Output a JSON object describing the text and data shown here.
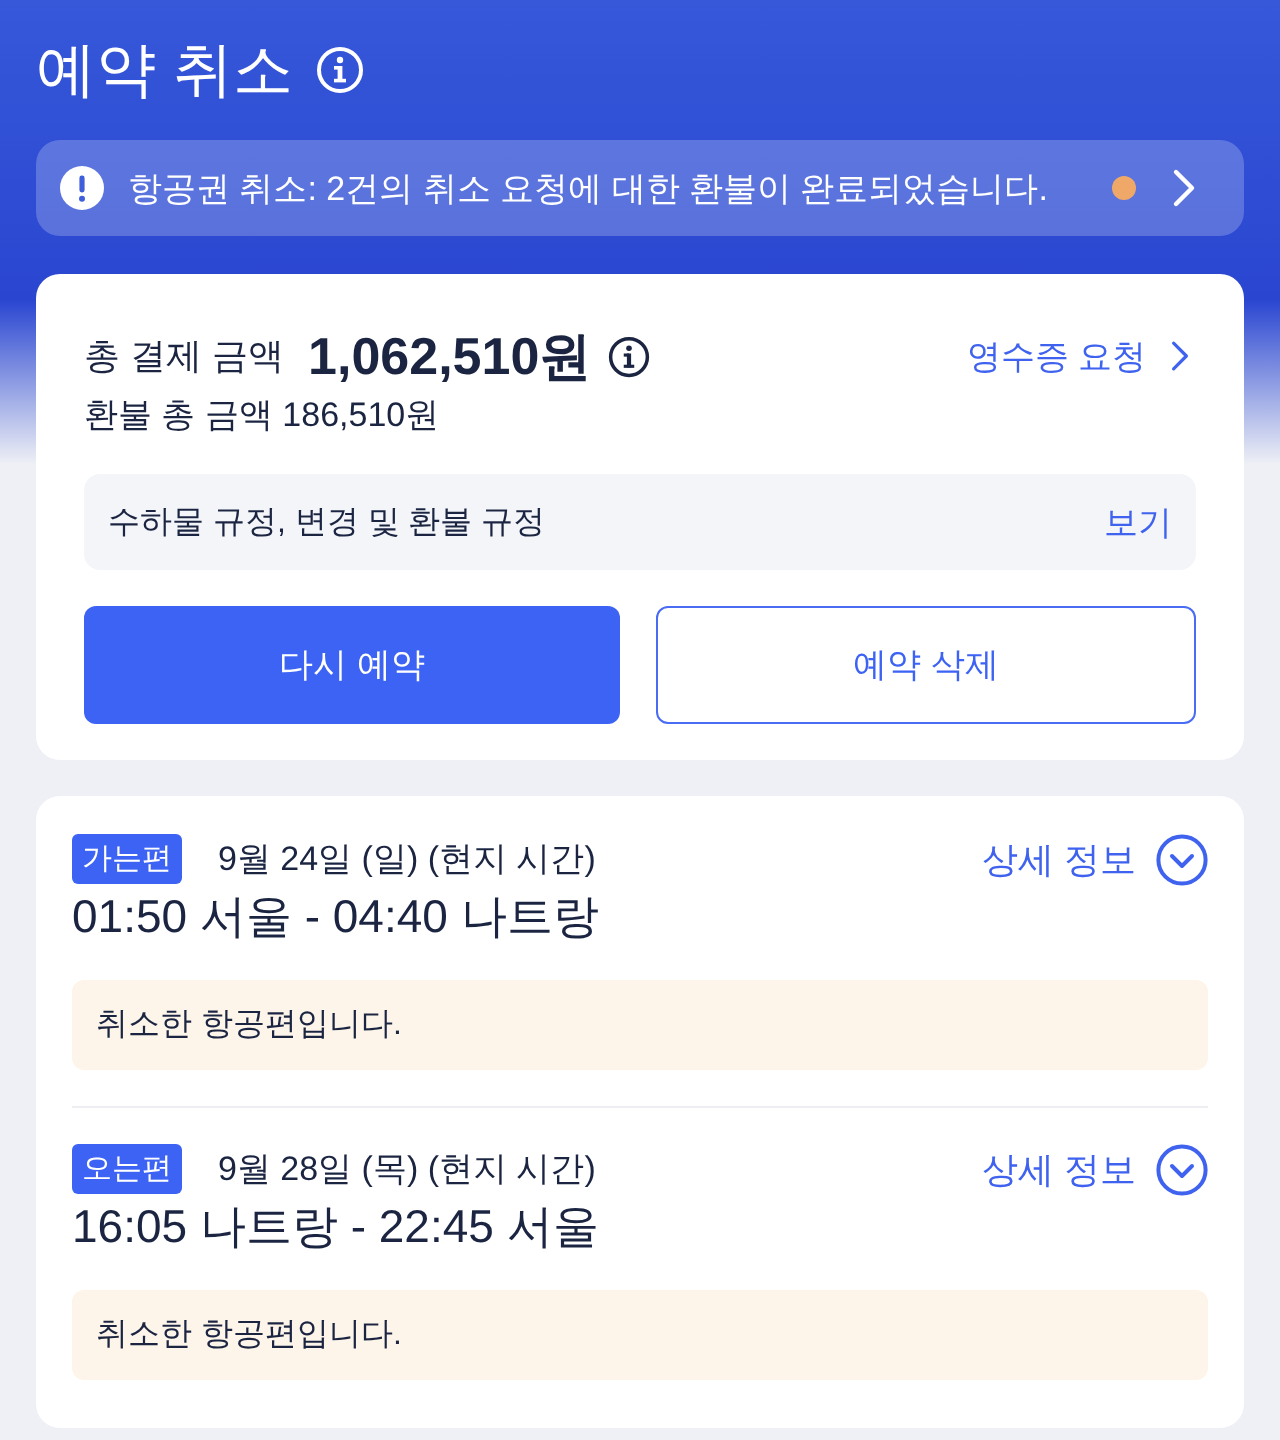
{
  "header": {
    "title": "예약 취소"
  },
  "notice_banner": {
    "text": "항공권 취소: 2건의 취소 요청에 대한 환불이 완료되었습니다.",
    "unread": true
  },
  "payment": {
    "total_label": "총 결제 금액",
    "total_amount": "1,062,510원",
    "receipt_link": "영수증 요청",
    "refund_text": "환불 총 금액 186,510원",
    "policy": {
      "label": "수하물 규정, 변경 및 환불 규정",
      "action": "보기"
    },
    "buttons": [
      {
        "label": "다시 예약",
        "kind": "primary"
      },
      {
        "label": "예약 삭제",
        "kind": "outline"
      }
    ]
  },
  "flights": [
    {
      "tag": "가는편",
      "date": "9월 24일 (일) (현지 시간)",
      "detail_link": "상세 정보",
      "expanded": false,
      "route": "01:50 서울 - 04:40 나트랑",
      "status": "취소한 항공편입니다."
    },
    {
      "tag": "오는편",
      "date": "9월 28일 (목) (현지 시간)",
      "detail_link": "상세 정보",
      "expanded": false,
      "route": "16:05 나트랑 - 22:45 서울",
      "status": "취소한 항공편입니다."
    }
  ]
}
